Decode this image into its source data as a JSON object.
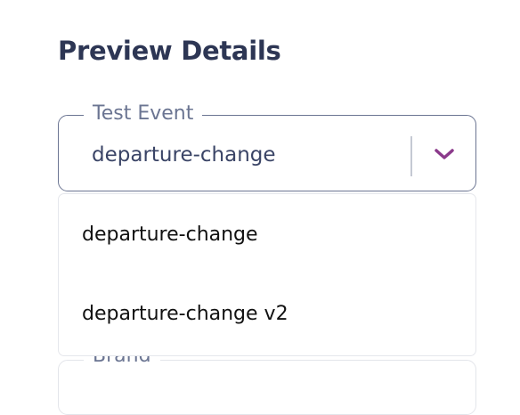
{
  "title": "Preview Details",
  "test_event": {
    "label": "Test Event",
    "value": "departure-change",
    "options": [
      "departure-change",
      "departure-change v2"
    ],
    "chevron_icon": "chevron-down-icon",
    "accent_color": "#8b3a8b"
  },
  "brand": {
    "label": "Brand"
  }
}
